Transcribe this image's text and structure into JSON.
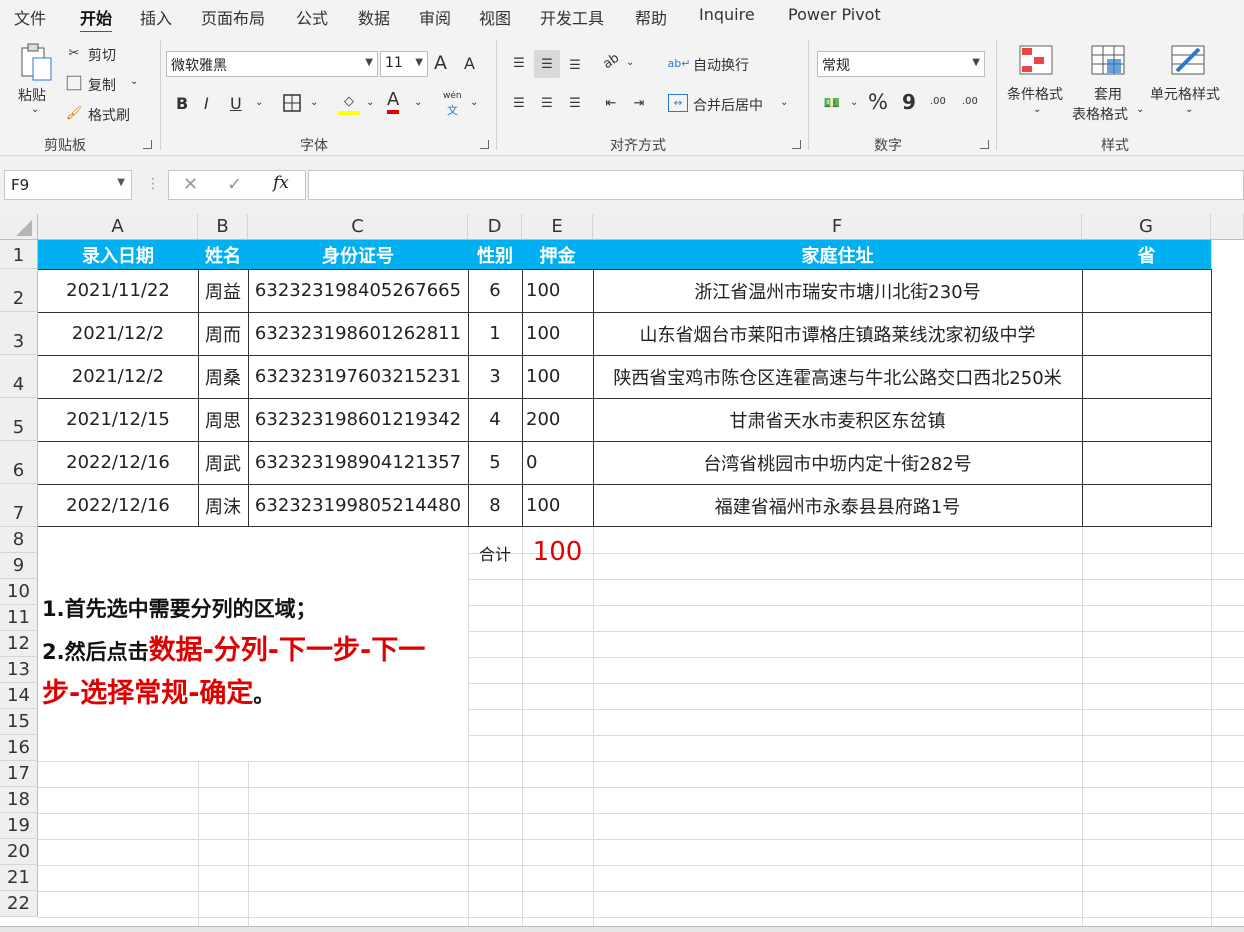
{
  "menu": [
    "文件",
    "开始",
    "插入",
    "页面布局",
    "公式",
    "数据",
    "审阅",
    "视图",
    "开发工具",
    "帮助",
    "Inquire",
    "Power Pivot"
  ],
  "ribbon": {
    "clipboard": {
      "paste": "粘贴",
      "cut": "剪切",
      "copy": "复制",
      "format_painter": "格式刷",
      "label": "剪贴板"
    },
    "font": {
      "name": "微软雅黑",
      "size": "11",
      "bold": "B",
      "italic": "I",
      "underline": "U",
      "grow": "A",
      "shrink": "A",
      "font_color": "A",
      "phonetic_top": "wén",
      "phonetic_bottom": "文",
      "label": "字体"
    },
    "align": {
      "wrap": "自动换行",
      "merge": "合并后居中",
      "label": "对齐方式"
    },
    "number": {
      "format": "常规",
      "percent": "%",
      "comma": "9",
      "inc_decimal": ".00",
      "dec_decimal": ".00",
      "label": "数字"
    },
    "styles": {
      "conditional": "条件格式",
      "table_line1": "套用",
      "table_line2": "表格格式",
      "cell_styles": "单元格样式",
      "label": "样式"
    }
  },
  "formula_bar": {
    "name_box": "F9",
    "fx": "fx"
  },
  "columns": [
    "A",
    "B",
    "C",
    "D",
    "E",
    "F",
    "G"
  ],
  "rows": [
    "1",
    "2",
    "3",
    "4",
    "5",
    "6",
    "7",
    "8",
    "9",
    "10",
    "11",
    "12",
    "13",
    "14",
    "15",
    "16",
    "17",
    "18",
    "19",
    "20",
    "21",
    "22"
  ],
  "table": {
    "headers": [
      "录入日期",
      "姓名",
      "身份证号",
      "性别",
      "押金",
      "家庭住址",
      "省"
    ],
    "rows": [
      [
        "2021/11/22",
        "周益",
        "632323198405267665",
        "6",
        "100",
        "浙江省温州市瑞安市塘川北街230号",
        ""
      ],
      [
        "2021/12/2",
        "周而",
        "632323198601262811",
        "1",
        "100",
        "山东省烟台市莱阳市谭格庄镇路莱线沈家初级中学",
        ""
      ],
      [
        "2021/12/2",
        "周桑",
        "632323197603215231",
        "3",
        "100",
        "陕西省宝鸡市陈仓区连霍高速与牛北公路交口西北250米",
        ""
      ],
      [
        "2021/12/15",
        "周思",
        "632323198601219342",
        "4",
        "200",
        "甘肃省天水市麦积区东岔镇",
        ""
      ],
      [
        "2022/12/16",
        "周武",
        "632323198904121357",
        "5",
        "0",
        "台湾省桃园市中坜内定十街282号",
        ""
      ],
      [
        "2022/12/16",
        "周沫",
        "632323199805214480",
        "8",
        "100",
        "福建省福州市永泰县县府路1号",
        ""
      ]
    ]
  },
  "total": {
    "label": "合计",
    "value": "100"
  },
  "note": {
    "line1": "1.首先选中需要分列的区域；",
    "line2_prefix": "2.然后点击",
    "line2_red": "数据-分列-下一步-下一步-选择常规-确定",
    "line2_suffix": "。"
  },
  "colors": {
    "header_fill": "#00b0f0",
    "accent": "#217346",
    "red": "#e00000"
  }
}
